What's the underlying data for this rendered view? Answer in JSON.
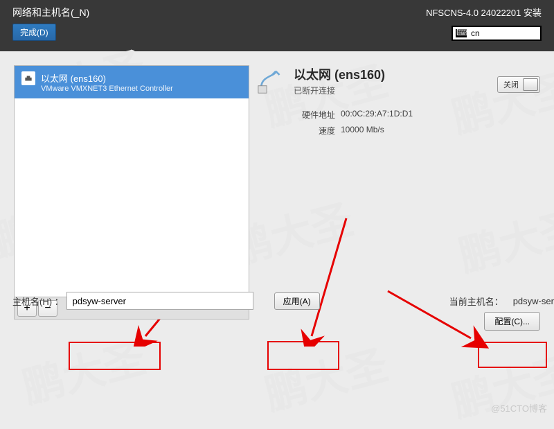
{
  "header": {
    "title": "网络和主机名(_N)",
    "done": "完成(D)",
    "install_line": "NFSCNS-4.0 24022201 安装",
    "lang": "cn"
  },
  "nic": {
    "name": "以太网 (ens160)",
    "desc": "VMware VMXNET3 Ethernet Controller"
  },
  "detail": {
    "title": "以太网 (ens160)",
    "status": "已断开连接",
    "toggle_state": "关闭",
    "hw_label": "硬件地址",
    "hw_value": "00:0C:29:A7:1D:D1",
    "speed_label": "速度",
    "speed_value": "10000 Mb/s",
    "config": "配置(C)..."
  },
  "hostname": {
    "label": "主机名(H) ：",
    "value": "pdsyw-server",
    "apply": "应用(A)",
    "current_label": "当前主机名：",
    "current_value": "pdsyw-server"
  },
  "watermark": "鹏大圣",
  "credit": "@51CTO博客"
}
